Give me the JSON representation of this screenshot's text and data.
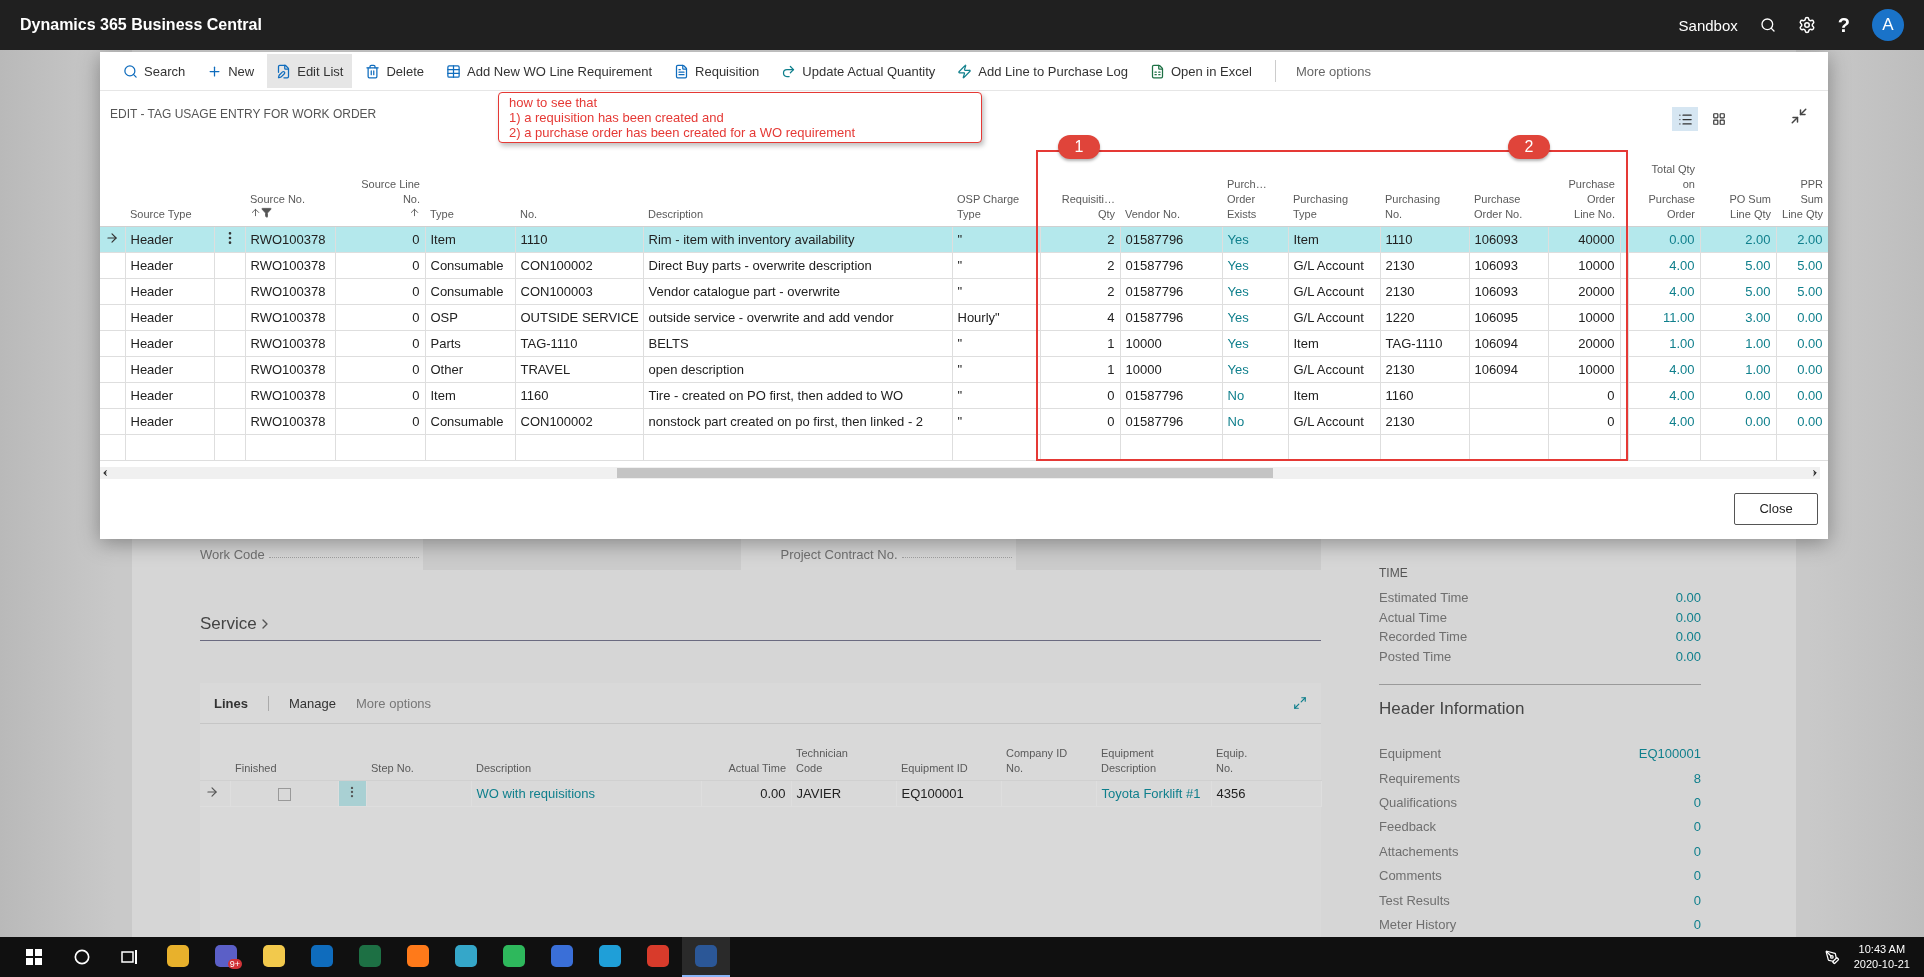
{
  "topbar": {
    "title": "Dynamics 365 Business Central",
    "environment": "Sandbox",
    "help": "?",
    "avatar": "A"
  },
  "page": {
    "fields": [
      {
        "label": "Work Code"
      },
      {
        "label": "Project Contract No."
      }
    ],
    "service": {
      "title": "Service",
      "lines_title": "Lines",
      "actions": [
        "Manage"
      ],
      "more": "More options",
      "finished_label": "Finished",
      "columns": [
        {
          "label": "Step No.",
          "kind": "text"
        },
        {
          "label": "Description",
          "kind": "link"
        },
        {
          "label": "Actual Time",
          "kind": "number"
        },
        {
          "label": "Technician\nCode",
          "kind": "text"
        },
        {
          "label": "Equipment ID",
          "kind": "text"
        },
        {
          "label": "Company ID\nNo.",
          "kind": "text"
        },
        {
          "label": "Equipment Description",
          "kind": "link"
        },
        {
          "label": "Equip.\nNo.",
          "kind": "text"
        }
      ],
      "rows": [
        {
          "selected": true,
          "finished": false,
          "cells": [
            "",
            "WO with requisitions",
            "0.00",
            "JAVIER",
            "EQ100001",
            "",
            "Toyota Forklift #1",
            "4356"
          ]
        }
      ]
    },
    "factbox": {
      "time_title": "TIME",
      "time_rows": [
        {
          "label": "Estimated Time",
          "value": "0.00"
        },
        {
          "label": "Actual Time",
          "value": "0.00"
        },
        {
          "label": "Recorded Time",
          "value": "0.00"
        },
        {
          "label": "Posted Time",
          "value": "0.00"
        }
      ],
      "header_title": "Header Information",
      "header_rows": [
        {
          "label": "Equipment",
          "value": "EQ100001"
        },
        {
          "label": "Requirements",
          "value": "8"
        },
        {
          "label": "Qualifications",
          "value": "0"
        },
        {
          "label": "Feedback",
          "value": "0"
        },
        {
          "label": "Attachements",
          "value": "0"
        },
        {
          "label": "Comments",
          "value": "0"
        },
        {
          "label": "Test Results",
          "value": "0"
        },
        {
          "label": "Meter History",
          "value": "0"
        }
      ]
    }
  },
  "modal": {
    "actions": [
      {
        "label": "Search",
        "kind": "search",
        "selected": false
      },
      {
        "label": "New",
        "kind": "new",
        "selected": false
      },
      {
        "label": "Edit List",
        "kind": "edit",
        "selected": true
      },
      {
        "label": "Delete",
        "kind": "delete",
        "selected": false
      },
      {
        "label": "Add New WO Line Requirement",
        "kind": "table",
        "selected": false
      },
      {
        "label": "Requisition",
        "kind": "document",
        "selected": false
      },
      {
        "label": "Update Actual Quantity",
        "kind": "update",
        "selected": false
      },
      {
        "label": "Add Line to Purchase Log",
        "kind": "bolt",
        "selected": false
      },
      {
        "label": "Open in Excel",
        "kind": "excel",
        "selected": false
      }
    ],
    "more": "More options",
    "title": "EDIT - TAG USAGE ENTRY FOR WORK ORDER",
    "views": [
      {
        "kind": "list",
        "selected": true
      },
      {
        "kind": "tiles",
        "selected": false
      }
    ],
    "columns": [
      {
        "label": "Source Type",
        "kind": "text",
        "sorted": false,
        "filtered": false
      },
      {
        "label": "Source No.",
        "kind": "text",
        "sorted": true,
        "filtered": true
      },
      {
        "label": "Source Line\nNo.",
        "kind": "number",
        "sorted": true,
        "filtered": false
      },
      {
        "label": "Type",
        "kind": "text",
        "sorted": false,
        "filtered": false
      },
      {
        "label": "No.",
        "kind": "text",
        "sorted": false,
        "filtered": false
      },
      {
        "label": "Description",
        "kind": "text",
        "sorted": false,
        "filtered": false
      },
      {
        "label": "OSP Charge\nType",
        "kind": "text",
        "sorted": false,
        "filtered": false
      },
      {
        "label": "Requisiti…\nQty",
        "kind": "number",
        "sorted": false,
        "filtered": false
      },
      {
        "label": "Vendor No.",
        "kind": "text",
        "sorted": false,
        "filtered": false
      },
      {
        "label": "Purch…\nOrder\nExists",
        "kind": "link",
        "sorted": false,
        "filtered": false
      },
      {
        "label": "Purchasing\nType",
        "kind": "text",
        "sorted": false,
        "filtered": false
      },
      {
        "label": "Purchasing\nNo.",
        "kind": "text",
        "sorted": false,
        "filtered": false
      },
      {
        "label": "Purchase\nOrder No.",
        "kind": "text",
        "sorted": false,
        "filtered": false
      },
      {
        "label": "Purchase\nOrder\nLine No.",
        "kind": "number",
        "sorted": false,
        "filtered": false
      },
      {
        "label": "Total Qty\non\nPurchase\nOrder",
        "kind": "linknumber",
        "sorted": false,
        "filtered": false
      },
      {
        "label": "PO Sum\nLine Qty",
        "kind": "linknumber",
        "sorted": false,
        "filtered": false
      },
      {
        "label": "PPR Sum\nLine Qty",
        "kind": "linknumber",
        "sorted": false,
        "filtered": false
      }
    ],
    "rows": [
      {
        "selected": true,
        "cells": [
          "Header",
          "RWO100378",
          "0",
          "Item",
          "1110",
          "Rim - item with inventory availability",
          "\"",
          "2",
          "01587796",
          "Yes",
          "Item",
          "1110",
          "106093",
          "40000",
          "0.00",
          "2.00",
          "2.00"
        ]
      },
      {
        "selected": false,
        "cells": [
          "Header",
          "RWO100378",
          "0",
          "Consumable",
          "CON100002",
          "Direct Buy parts - overwrite description",
          "\"",
          "2",
          "01587796",
          "Yes",
          "G/L Account",
          "2130",
          "106093",
          "10000",
          "4.00",
          "5.00",
          "5.00"
        ]
      },
      {
        "selected": false,
        "cells": [
          "Header",
          "RWO100378",
          "0",
          "Consumable",
          "CON100003",
          "Vendor catalogue part - overwrite",
          "\"",
          "2",
          "01587796",
          "Yes",
          "G/L Account",
          "2130",
          "106093",
          "20000",
          "4.00",
          "5.00",
          "5.00"
        ]
      },
      {
        "selected": false,
        "cells": [
          "Header",
          "RWO100378",
          "0",
          "OSP",
          "OUTSIDE SERVICE",
          "outside service - overwrite and add vendor",
          "Hourly\"",
          "4",
          "01587796",
          "Yes",
          "G/L Account",
          "1220",
          "106095",
          "10000",
          "11.00",
          "3.00",
          "0.00"
        ]
      },
      {
        "selected": false,
        "cells": [
          "Header",
          "RWO100378",
          "0",
          "Parts",
          "TAG-1110",
          "BELTS",
          "\"",
          "1",
          "10000",
          "Yes",
          "Item",
          "TAG-1110",
          "106094",
          "20000",
          "1.00",
          "1.00",
          "0.00"
        ]
      },
      {
        "selected": false,
        "cells": [
          "Header",
          "RWO100378",
          "0",
          "Other",
          "TRAVEL",
          "open description",
          "\"",
          "1",
          "10000",
          "Yes",
          "G/L Account",
          "2130",
          "106094",
          "10000",
          "4.00",
          "1.00",
          "0.00"
        ]
      },
      {
        "selected": false,
        "cells": [
          "Header",
          "RWO100378",
          "0",
          "Item",
          "1160",
          "Tire - created on PO first, then added to WO",
          "\"",
          "0",
          "01587796",
          "No",
          "Item",
          "1160",
          "",
          "0",
          "4.00",
          "0.00",
          "0.00"
        ]
      },
      {
        "selected": false,
        "cells": [
          "Header",
          "RWO100378",
          "0",
          "Consumable",
          "CON100002",
          "nonstock part created on po first, then linked - 2",
          "\"",
          "0",
          "01587796",
          "No",
          "G/L Account",
          "2130",
          "",
          "0",
          "4.00",
          "0.00",
          "0.00"
        ]
      }
    ],
    "close": "Close",
    "annotation": [
      "how to see that",
      "1) a requisition has been created and",
      "2) a purchase order has been created for a WO requirement"
    ],
    "markers": [
      "1",
      "2"
    ]
  },
  "taskbar": {
    "apps": [
      {
        "color": "#e8b12c",
        "active": false
      },
      {
        "color": "#5b5fc7",
        "badge": "9+",
        "active": false
      },
      {
        "color": "#f2c94c",
        "active": false
      },
      {
        "color": "#0f6cbd",
        "active": false
      },
      {
        "color": "#1d7044",
        "active": false
      },
      {
        "color": "#ff7a1a",
        "active": false
      },
      {
        "color": "#35a7c9",
        "active": false
      },
      {
        "color": "#2eb85c",
        "active": false
      },
      {
        "color": "#3a6fd8",
        "active": false
      },
      {
        "color": "#1f9fd8",
        "active": false
      },
      {
        "color": "#d83b2b",
        "active": false
      },
      {
        "color": "#2b5797",
        "active": true
      }
    ],
    "time": "10:43 AM",
    "date": "2020-10-21"
  }
}
